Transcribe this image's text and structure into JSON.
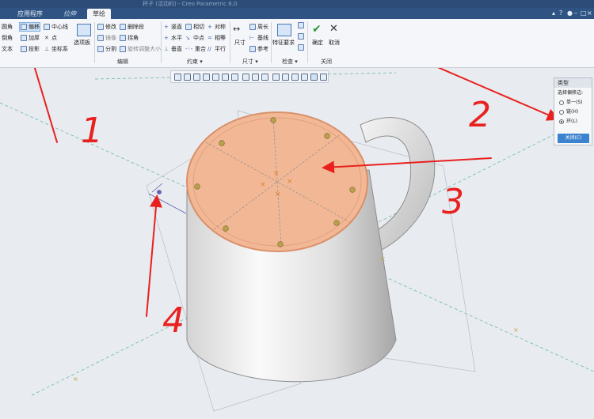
{
  "window": {
    "title": "杯子 (活动的) - Creo Parametric 6.0",
    "controls": [
      "▴",
      "?",
      "●",
      "–",
      "□",
      "×"
    ]
  },
  "tabs": [
    {
      "label": "应用程序"
    },
    {
      "label": "拉伸"
    },
    {
      "label": "草绘"
    }
  ],
  "ribbon": {
    "sketch": {
      "fillet": "圆角",
      "offset": "偏移",
      "centerline": "中心线",
      "chamfer": "倒角",
      "thicken": "加厚",
      "point": "点",
      "text": "文本",
      "project": "投影",
      "coordsys": "坐标系",
      "palette": "选项板"
    },
    "edit": {
      "modify": "修改",
      "delete_segment": "删除段",
      "mirror": "镜像",
      "corner": "拐角",
      "divide": "分割",
      "rotate_resize": "旋转调整大小",
      "group": "编辑"
    },
    "constrain": {
      "vertical": "竖直",
      "tangent": "相切",
      "symmetric": "对称",
      "horizontal": "水平",
      "midpoint": "中点",
      "equal": "相等",
      "perpendicular": "垂直",
      "coincident": "重合",
      "parallel": "平行",
      "group": "约束 ▾"
    },
    "dimension": {
      "dimension": "尺寸",
      "perimeter": "周长",
      "baseline": "基线",
      "reference": "参考",
      "group": "尺寸 ▾"
    },
    "inspect": {
      "feature_req": "特征要求",
      "group": "检查 ▾"
    },
    "close": {
      "ok": "确定",
      "cancel": "取消",
      "group": "关闭"
    }
  },
  "panel": {
    "title": "类型",
    "subtitle": "选择偏移边:",
    "options": [
      {
        "label": "单一(S)",
        "selected": false
      },
      {
        "label": "链(H)",
        "selected": false
      },
      {
        "label": "环(L)",
        "selected": true
      }
    ],
    "close_label": "关闭(C)"
  },
  "annotations": [
    "1",
    "2",
    "3",
    "4"
  ],
  "colors": {
    "sketch_face": "#f2b896",
    "arrows": "#e8211f",
    "ribbon_bg": "#f4f6f9",
    "tabbar_bg": "#2f5483",
    "viewport_bg": "#e8ebef"
  }
}
